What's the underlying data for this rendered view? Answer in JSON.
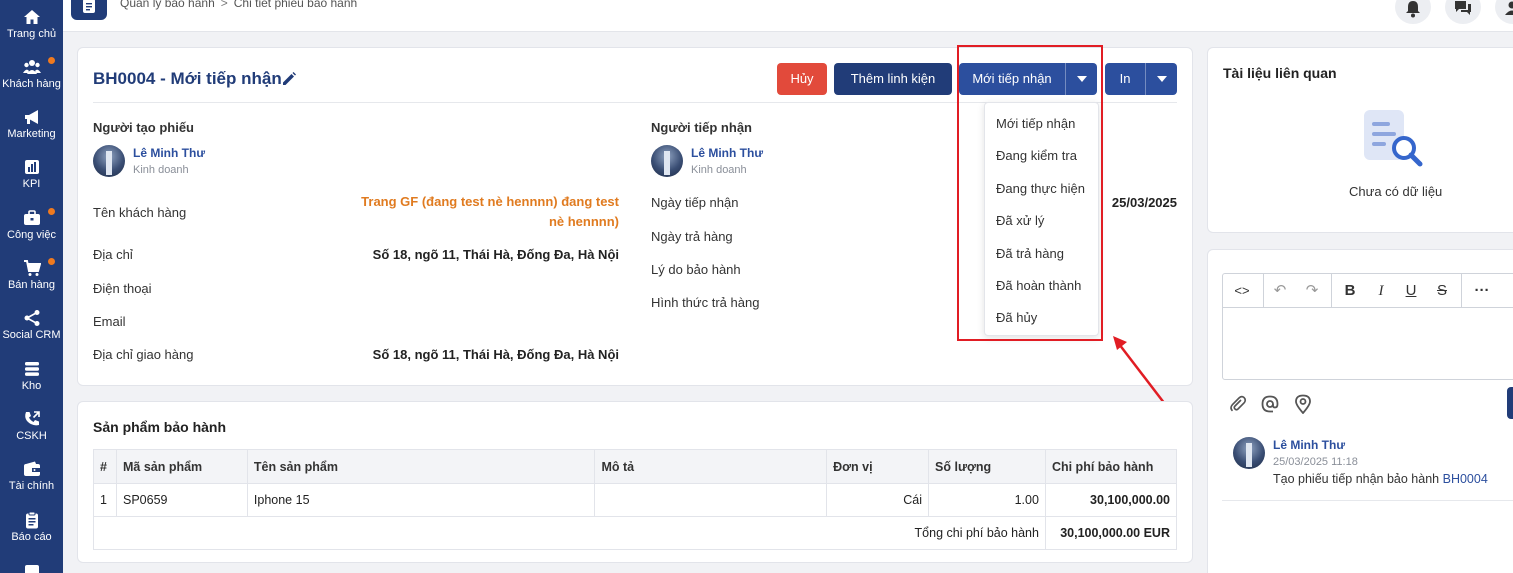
{
  "sidebar": {
    "items": [
      {
        "label": "Trang chủ",
        "icon": "home-icon",
        "badge": false
      },
      {
        "label": "Khách hàng",
        "icon": "users-icon",
        "badge": true
      },
      {
        "label": "Marketing",
        "icon": "megaphone-icon",
        "badge": false
      },
      {
        "label": "KPI",
        "icon": "chart-icon",
        "badge": false
      },
      {
        "label": "Công việc",
        "icon": "briefcase-icon",
        "badge": true
      },
      {
        "label": "Bán hàng",
        "icon": "cart-icon",
        "badge": true
      },
      {
        "label": "Social CRM",
        "icon": "share-icon",
        "badge": false
      },
      {
        "label": "Kho",
        "icon": "stack-icon",
        "badge": false
      },
      {
        "label": "CSKH",
        "icon": "phone-icon",
        "badge": false
      },
      {
        "label": "Tài chính",
        "icon": "wallet-icon",
        "badge": false
      },
      {
        "label": "Báo cáo",
        "icon": "clipboard-icon",
        "badge": false
      }
    ]
  },
  "breadcrumb": {
    "root": "Quản lý bảo hành",
    "separator": ">",
    "current": "Chi tiết phiếu bảo hành"
  },
  "ticket": {
    "title": "BH0004 - Mới tiếp nhận",
    "buttons": {
      "cancel": "Hủy",
      "add_part": "Thêm linh kiện",
      "status": "Mới tiếp nhận",
      "print": "In"
    },
    "creator": {
      "heading": "Người tạo phiếu",
      "name": "Lê Minh Thư",
      "role": "Kinh doanh"
    },
    "receiver": {
      "heading": "Người tiếp nhận",
      "name": "Lê Minh Thư",
      "role": "Kinh doanh"
    },
    "fields_left": [
      {
        "label": "Tên khách hàng",
        "value": "Trang GF (đang test nè hennnn) đang test nè hennnn)"
      },
      {
        "label": "Địa chỉ",
        "value": "Số 18, ngõ 11, Thái Hà, Đống Đa, Hà Nội"
      },
      {
        "label": "Điện thoại",
        "value": ""
      },
      {
        "label": "Email",
        "value": ""
      },
      {
        "label": "Địa chỉ giao hàng",
        "value": "Số 18, ngõ 11, Thái Hà, Đống Đa, Hà Nội"
      }
    ],
    "fields_right": [
      {
        "label": "Ngày tiếp nhận",
        "value": "25/03/2025"
      },
      {
        "label": "Ngày trả hàng",
        "value": ""
      },
      {
        "label": "Lý do bảo hành",
        "value": ""
      },
      {
        "label": "Hình thức trả hàng",
        "value": ""
      }
    ]
  },
  "status_dropdown": {
    "options": [
      "Mới tiếp nhận",
      "Đang kiểm tra",
      "Đang thực hiện",
      "Đã xử lý",
      "Đã trả hàng",
      "Đã hoàn thành",
      "Đã hủy"
    ]
  },
  "products": {
    "title": "Sản phẩm bảo hành",
    "columns": [
      "#",
      "Mã sản phẩm",
      "Tên sản phẩm",
      "Mô tả",
      "Đơn vị",
      "Số lượng",
      "Chi phí bảo hành"
    ],
    "rows": [
      {
        "index": "1",
        "code": "SP0659",
        "name": "Iphone 15",
        "desc": "",
        "unit": "Cái",
        "qty": "1.00",
        "cost": "30,100,000.00"
      }
    ],
    "total_label": "Tổng chi phí bảo hành",
    "total_value": "30,100,000.00 EUR"
  },
  "related_docs": {
    "title": "Tài liệu liên quan",
    "empty": "Chưa có dữ liệu"
  },
  "activity": [
    {
      "name": "Lê Minh Thư",
      "time": "25/03/2025 11:18",
      "text": "Tạo phiếu tiếp nhận bảo hành",
      "link": "BH0004"
    }
  ],
  "colors": {
    "brand": "#213c78",
    "accent_orange": "#e07b20",
    "danger": "#e24a3b",
    "highlight": "#e11d24"
  }
}
